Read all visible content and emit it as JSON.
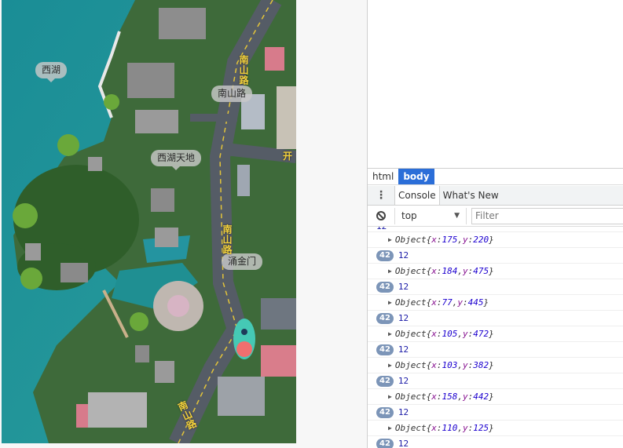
{
  "map": {
    "labels": {
      "west_lake": "西湖",
      "nanshan_road": "南山路",
      "xihu_tiandi": "西湖天地",
      "yongjinmen": "涌金门"
    },
    "road_texts": {
      "top": "南山路",
      "middle": "南山路",
      "bottom": "南山路",
      "side": "开"
    }
  },
  "devtools": {
    "breadcrumb": [
      "html",
      "body"
    ],
    "tabs": {
      "kebab": "⋮",
      "console": "Console",
      "whats_new": "What's New"
    },
    "toolbar": {
      "context": "top",
      "filter_placeholder": "Filter"
    },
    "console": {
      "top_partial": "12",
      "entries": [
        {
          "x": "175",
          "y": "220",
          "count": "42",
          "value": "12"
        },
        {
          "x": "184",
          "y": "475",
          "count": "42",
          "value": "12"
        },
        {
          "x": "77",
          "y": "445",
          "count": "42",
          "value": "12"
        },
        {
          "x": "105",
          "y": "472",
          "count": "42",
          "value": "12"
        },
        {
          "x": "103",
          "y": "382",
          "count": "42",
          "value": "12"
        },
        {
          "x": "158",
          "y": "442",
          "count": "42",
          "value": "12"
        },
        {
          "x": "110",
          "y": "125",
          "count": "42",
          "value": "12"
        }
      ],
      "object_label": "Object"
    }
  },
  "colors": {
    "water": "#1f8f92",
    "accent": "#2b6ed8",
    "badge": "#7c95b8",
    "road_label": "#f4d23c"
  }
}
